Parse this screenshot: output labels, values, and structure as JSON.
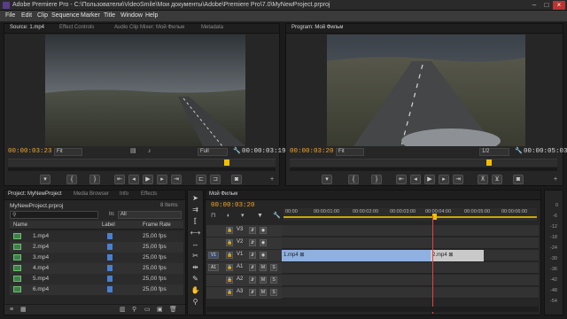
{
  "window": {
    "title": "Adobe Premiere Pro - C:\\Пользователи\\VideoSmile\\Мои документы\\Adobe\\Premiere Pro\\7.0\\MyNewProject.prproj",
    "minimize": "–",
    "maximize": "□",
    "close": "×"
  },
  "menu": [
    "File",
    "Edit",
    "Clip",
    "Sequence",
    "Marker",
    "Title",
    "Window",
    "Help"
  ],
  "source": {
    "tabs": [
      "Source: 1.mp4",
      "Effect Controls",
      "Audio Clip Mixer: Мой Фильм",
      "Metadata"
    ],
    "timecode_in": "00:00:03:23",
    "zoom": "Fit",
    "quality": "Full",
    "duration": "00:00:03:19"
  },
  "program": {
    "tab": "Program: Мой Фильм",
    "timecode": "00:00:03:20",
    "zoom": "Fit",
    "resolution": "1/2",
    "duration": "00:00:05:03"
  },
  "transport_icons": [
    "marker",
    "in",
    "out",
    "go-in",
    "step-back",
    "play",
    "step-fwd",
    "go-out",
    "insert",
    "overwrite",
    "export-frame"
  ],
  "project": {
    "tabs": [
      "Project: MyNewProject",
      "Media Browser",
      "Info",
      "Effects"
    ],
    "file": "MyNewProject.prproj",
    "item_count": "8 Items",
    "search_placeholder": "",
    "in_label": "In:",
    "in_value": "All",
    "columns": [
      "Name",
      "Label",
      "Frame Rate"
    ],
    "items": [
      {
        "name": "1.mp4",
        "fps": "25,00 fps"
      },
      {
        "name": "2.mp4",
        "fps": "25,00 fps"
      },
      {
        "name": "3.mp4",
        "fps": "25,00 fps"
      },
      {
        "name": "4.mp4",
        "fps": "25,00 fps"
      },
      {
        "name": "5.mp4",
        "fps": "25,00 fps"
      },
      {
        "name": "6.mp4",
        "fps": "25,00 fps"
      }
    ]
  },
  "timeline": {
    "tab": "Мой Фильм",
    "timecode": "00:00:03:20",
    "ruler": [
      "00:00",
      "00:00:01:00",
      "00:00:02:00",
      "00:00:03:00",
      "00:00:04:00",
      "00:00:05:00",
      "00:00:06:00"
    ],
    "tracks": [
      {
        "name": "V3",
        "type": "video"
      },
      {
        "name": "V2",
        "type": "video"
      },
      {
        "name": "V1",
        "type": "video",
        "src": "V1"
      },
      {
        "name": "A1",
        "type": "audio",
        "src": "A1"
      },
      {
        "name": "A2",
        "type": "audio"
      },
      {
        "name": "A3",
        "type": "audio"
      }
    ],
    "clips": [
      {
        "label": "1.mp4 ⊠",
        "track": "V1"
      },
      {
        "label": "2.mp4 ⊠",
        "track": "V1"
      }
    ],
    "toggle_m": "M",
    "toggle_s": "S"
  },
  "audio_meter": {
    "ticks": [
      "0",
      "-6",
      "-12",
      "-18",
      "-24",
      "-30",
      "-36",
      "-42",
      "-48",
      "-54"
    ]
  },
  "colors": {
    "timecode": "#f0a62d",
    "clip_video": "#8fb0e0",
    "clip_selected": "#c9c9c9",
    "playhead": "#e84040",
    "accent": "#f0c000"
  }
}
